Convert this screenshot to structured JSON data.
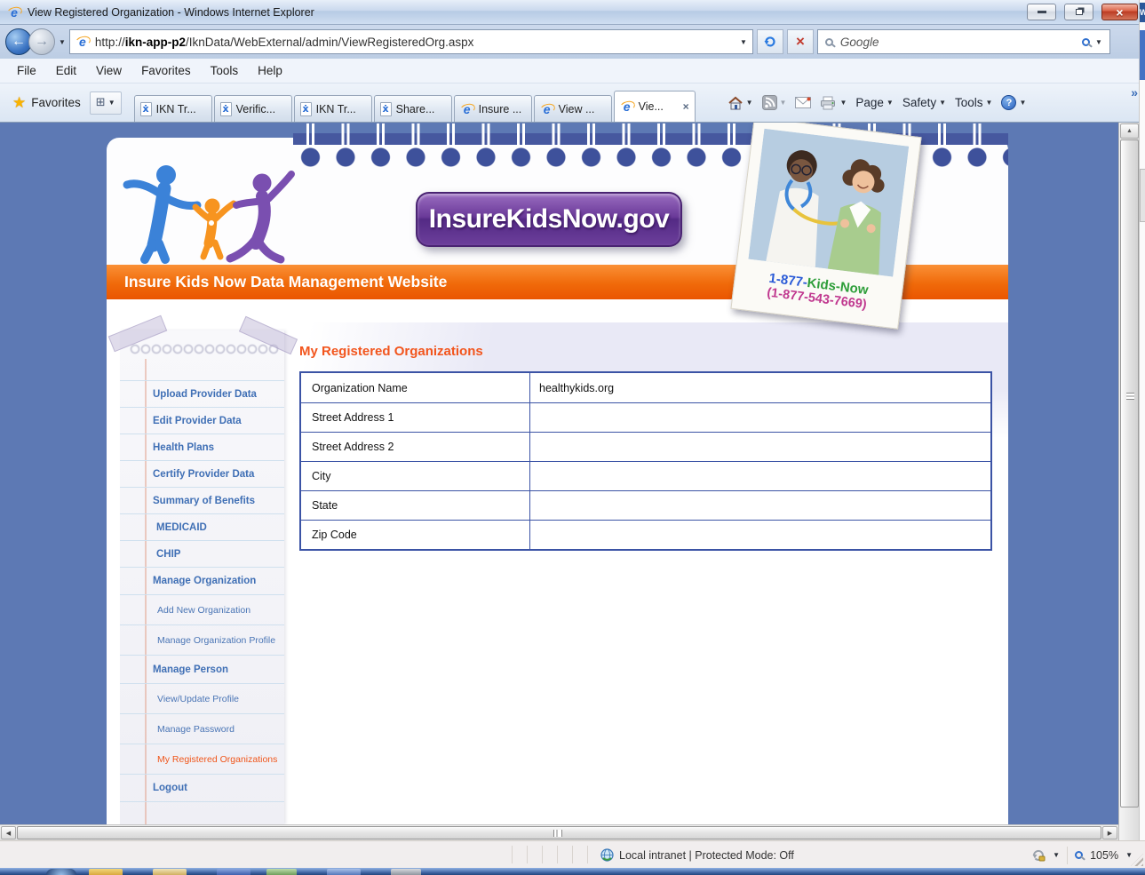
{
  "window": {
    "title": "View Registered Organization - Windows Internet Explorer"
  },
  "toolbar": {
    "url_prefix": "http://",
    "url_host": "ikn-app-p2",
    "url_path": "/IknData/WebExternal/admin/ViewRegisteredOrg.aspx",
    "search_placeholder": "Google"
  },
  "menu": {
    "items": [
      "File",
      "Edit",
      "View",
      "Favorites",
      "Tools",
      "Help"
    ]
  },
  "favorites_bar": {
    "favorites_label": "Favorites",
    "tabs": [
      {
        "label": "IKN Tr...",
        "icon": "doc-person"
      },
      {
        "label": "Verific...",
        "icon": "doc-person"
      },
      {
        "label": "IKN Tr...",
        "icon": "doc-person"
      },
      {
        "label": "Share...",
        "icon": "doc-person"
      },
      {
        "label": "Insure ...",
        "icon": "ie"
      },
      {
        "label": "View ...",
        "icon": "ie"
      },
      {
        "label": "Vie...",
        "icon": "ie",
        "active": true
      }
    ],
    "commands": {
      "page": "Page",
      "safety": "Safety",
      "tools": "Tools"
    }
  },
  "banner": {
    "logo_text": "InsureKidsNow.gov",
    "site_title": "Insure Kids Now Data Management Website",
    "phone_prefix": "1-877-",
    "phone_word": "Kids-Now",
    "phone_digits": "(1-877-543-7669)"
  },
  "sidebar": {
    "items": [
      {
        "label": "Upload Provider Data"
      },
      {
        "label": "Edit Provider Data"
      },
      {
        "label": "Health Plans"
      },
      {
        "label": "Certify Provider Data"
      },
      {
        "label": "Summary of Benefits"
      },
      {
        "label": "MEDICAID"
      },
      {
        "label": "CHIP"
      },
      {
        "label": "Manage Organization"
      },
      {
        "label": "Add New Organization"
      },
      {
        "label": "Manage Organization Profile"
      },
      {
        "label": "Manage Person"
      },
      {
        "label": "View/Update Profile"
      },
      {
        "label": "Manage Password"
      },
      {
        "label": "My Registered Organizations",
        "active": true
      },
      {
        "label": "Logout"
      }
    ]
  },
  "main": {
    "heading": "My Registered Organizations",
    "table": {
      "rows": [
        {
          "label": "Organization Name",
          "value": "healthykids.org"
        },
        {
          "label": "Street Address 1",
          "value": ""
        },
        {
          "label": "Street Address 2",
          "value": ""
        },
        {
          "label": "City",
          "value": ""
        },
        {
          "label": "State",
          "value": ""
        },
        {
          "label": "Zip Code",
          "value": ""
        }
      ]
    }
  },
  "status_bar": {
    "zone_text": "Local intranet | Protected Mode: Off",
    "zoom_level": "105%"
  },
  "icons": {
    "ie_logo": "e",
    "doc_person": "ẋ",
    "favorites_star": "★",
    "quick_tabs": "⊞",
    "dropdown": "▼",
    "back_arrow": "←",
    "forward_arrow": "→",
    "stop_x": "×",
    "close_x": "×",
    "minimize": "",
    "mail": "✉",
    "home": "⌂",
    "help_mark": "?",
    "chevron": "»",
    "scroll_up": "▲",
    "scroll_left": "◀",
    "scroll_right": "▶",
    "word_w": "W"
  },
  "colors": {
    "accent_orange": "#f0551a",
    "page_blue": "#5d79b4",
    "table_border": "#3b53a5",
    "sidebar_link": "#3f6fb5",
    "logo_purple": "#5c2e8a"
  }
}
